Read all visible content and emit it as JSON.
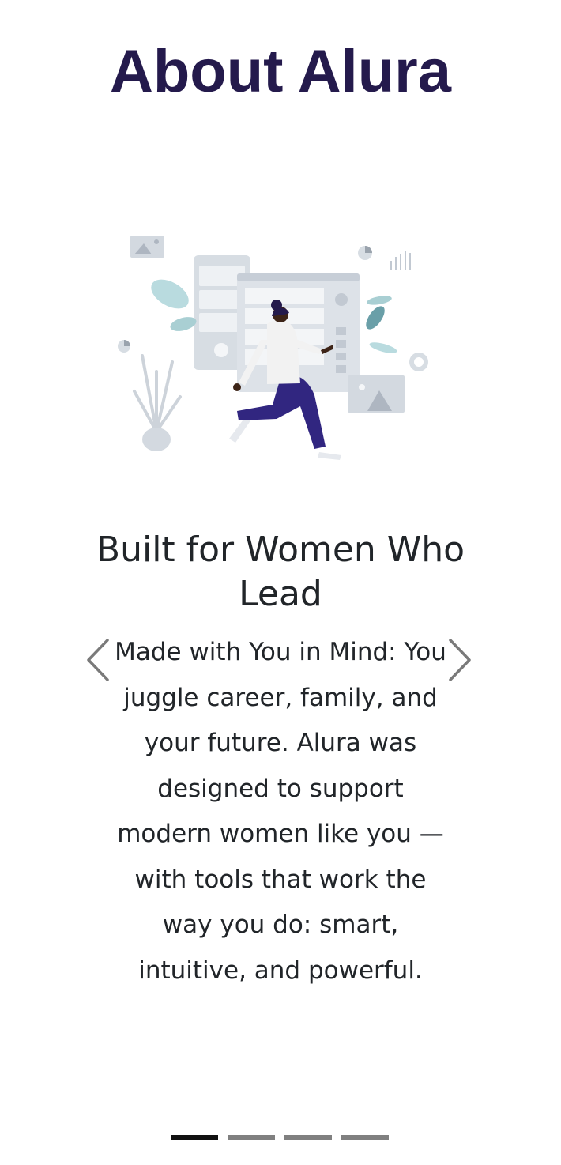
{
  "page": {
    "title": "About Alura"
  },
  "carousel": {
    "active_index": 0,
    "slide": {
      "heading": "Built for Women Who Lead",
      "body": "Made with You in Mind: You juggle career, family, and your future. Alura was designed to support modern women like you — with tools that work the way you do: smart, intuitive, and powerful.",
      "illustration": "woman-running-dashboard-illustration"
    },
    "controls": {
      "prev_icon": "chevron-left-icon",
      "next_icon": "chevron-right-icon"
    },
    "indicator_count": 4
  },
  "colors": {
    "title": "#241a4c",
    "text": "#212529",
    "indicator_active": "#111111",
    "indicator_inactive": "#808080"
  }
}
